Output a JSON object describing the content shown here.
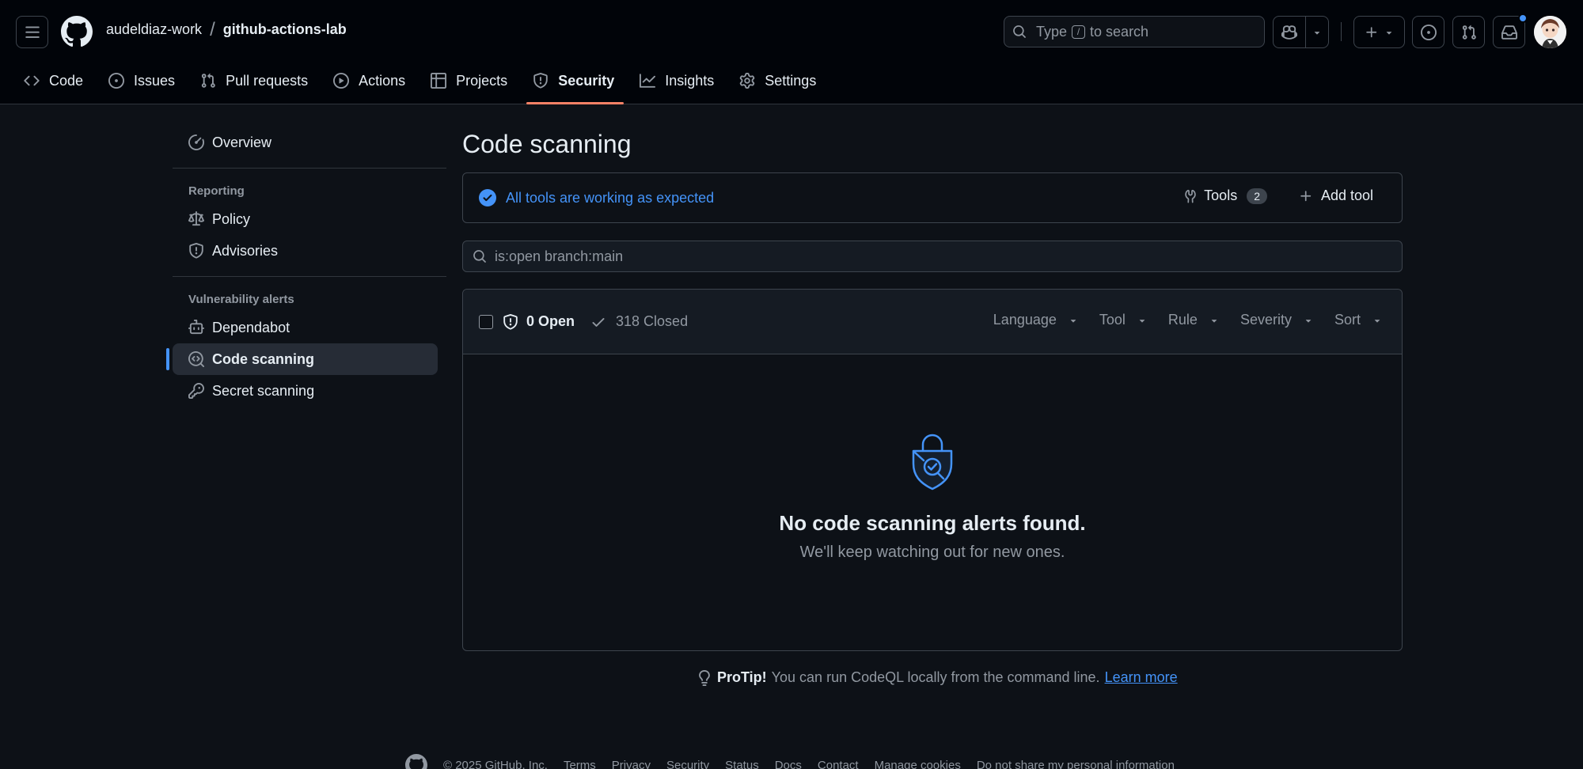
{
  "header": {
    "owner": "audeldiaz-work",
    "separator": "/",
    "repo": "github-actions-lab",
    "search_prefix": "Type",
    "search_key": "/",
    "search_suffix": "to search"
  },
  "repo_nav": [
    {
      "label": "Code",
      "icon": "code-icon"
    },
    {
      "label": "Issues",
      "icon": "issue-opened-icon"
    },
    {
      "label": "Pull requests",
      "icon": "git-pull-request-icon"
    },
    {
      "label": "Actions",
      "icon": "play-icon"
    },
    {
      "label": "Projects",
      "icon": "table-icon"
    },
    {
      "label": "Security",
      "icon": "shield-icon",
      "active": true
    },
    {
      "label": "Insights",
      "icon": "graph-icon"
    },
    {
      "label": "Settings",
      "icon": "gear-icon"
    }
  ],
  "sidebar": {
    "overview": "Overview",
    "reporting_heading": "Reporting",
    "policy": "Policy",
    "advisories": "Advisories",
    "vuln_heading": "Vulnerability alerts",
    "dependabot": "Dependabot",
    "code_scanning": "Code scanning",
    "secret_scanning": "Secret scanning"
  },
  "main": {
    "title": "Code scanning",
    "status_text": "All tools are working as expected",
    "tools_label": "Tools",
    "tools_count": "2",
    "add_tool_label": "Add tool",
    "filter_value": "is:open branch:main",
    "open_label": "0 Open",
    "closed_label": "318 Closed",
    "filters": [
      "Language",
      "Tool",
      "Rule",
      "Severity",
      "Sort"
    ],
    "empty_title": "No code scanning alerts found.",
    "empty_sub": "We'll keep watching out for new ones."
  },
  "protip": {
    "label": "ProTip!",
    "text": "You can run CodeQL locally from the command line.",
    "link": "Learn more"
  },
  "footer": {
    "copyright": "© 2025 GitHub, Inc.",
    "links": [
      "Terms",
      "Privacy",
      "Security",
      "Status",
      "Docs",
      "Contact",
      "Manage cookies",
      "Do not share my personal information"
    ]
  },
  "colors": {
    "accent": "#4493f8",
    "nav_underline": "#f78166",
    "background": "#0d1117"
  }
}
